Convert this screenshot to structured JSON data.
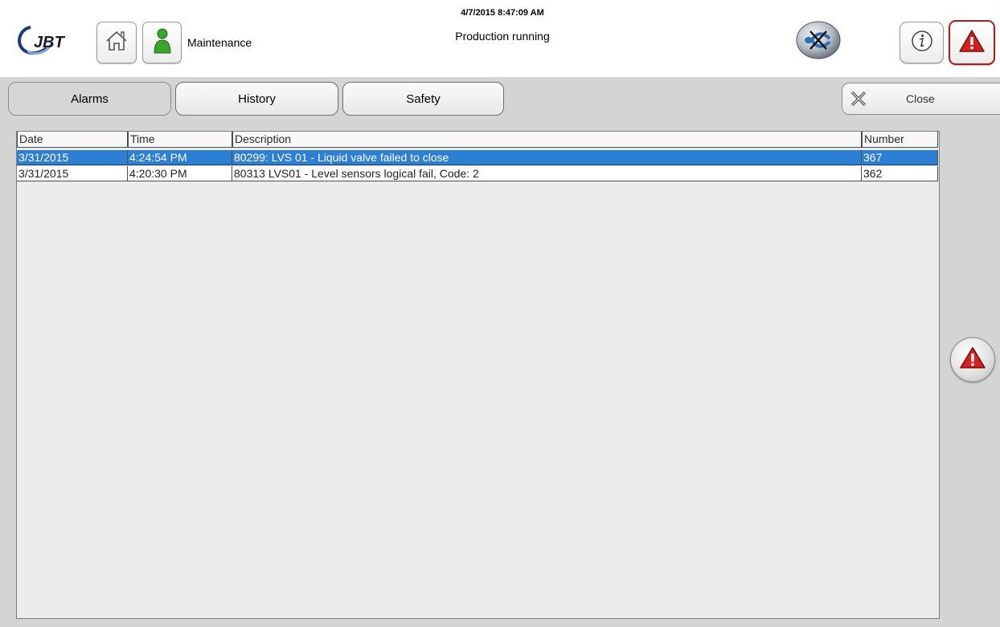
{
  "header": {
    "logo_text": "JBT",
    "user_label": "Maintenance",
    "datetime": "4/7/2015 8:47:09 AM",
    "status": "Production running",
    "icons": {
      "home": "home-icon",
      "user": "user-icon",
      "comm": "communication-error-icon",
      "info": "info-icon",
      "alarm": "alarm-warning-icon"
    }
  },
  "tabs": [
    {
      "label": "Alarms",
      "active": true
    },
    {
      "label": "History",
      "active": false
    },
    {
      "label": "Safety",
      "active": false
    }
  ],
  "close_button": {
    "label": "Close",
    "icon": "close-icon"
  },
  "alarm_table": {
    "columns": [
      "Date",
      "Time",
      "Description",
      "Number"
    ],
    "rows": [
      {
        "date": "3/31/2015",
        "time": "4:24:54 PM",
        "description": "80299: LVS 01 - Liquid valve failed to close",
        "number": "367",
        "selected": true
      },
      {
        "date": "3/31/2015",
        "time": "4:20:30 PM",
        "description": "80313 LVS01 -  Level sensors logical fail,  Code: 2",
        "number": "362",
        "selected": false
      }
    ]
  },
  "colors": {
    "selected_row": "#2c7fd3",
    "panel_background": "#d4d4d4",
    "alarm_red": "#d42020",
    "user_green": "#3aa52a"
  }
}
